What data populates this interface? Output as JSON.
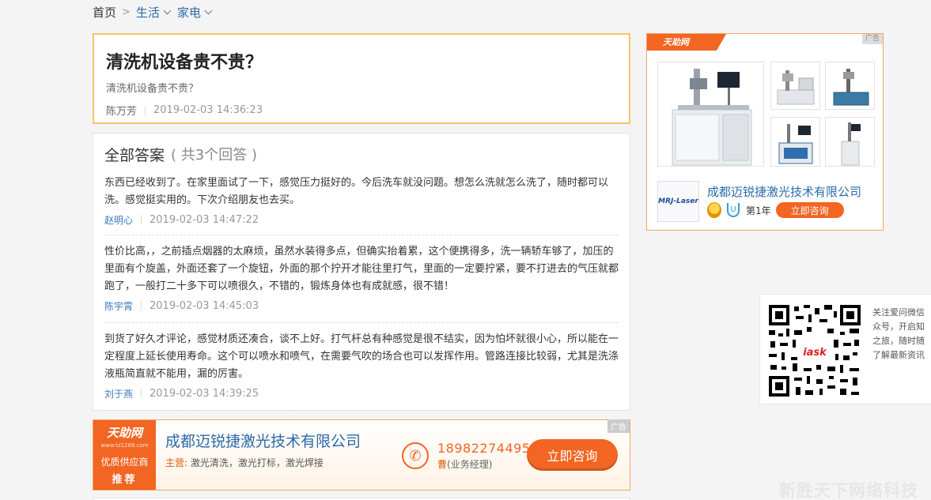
{
  "breadcrumb": {
    "home": "首页",
    "separator": ">",
    "level1": "生活",
    "level2": "家电"
  },
  "question": {
    "title": "清洗机设备贵不贵？",
    "description": "清洗机设备贵不贵？",
    "author": "陈万芳",
    "time": "2019-02-03 14:36:23"
  },
  "answers_section": {
    "heading": "全部答案",
    "count_prefix": "( 共",
    "count": "3",
    "count_suffix": "个回答 )",
    "items": [
      {
        "text": "东西已经收到了。在家里面试了一下，感觉压力挺好的。今后洗车就没问题。想怎么洗就怎么洗了，随时都可以洗。感觉挺实用的。下次介绍朋友也去买。",
        "user": "赵明心",
        "time": "2019-02-03 14:47:22"
      },
      {
        "text": "性价比高，，之前插点烟器的太麻烦，虽然水装得多点，但确实抬着累，这个便携得多，洗一辆轿车够了，加压的里面有个旋盖，外面还套了一个旋钮，外面的那个拧开才能往里打气，里面的一定要拧紧，要不打进去的气压就都跑了，一般打二十多下可以喷很久，不错的，锻炼身体也有成就感，很不错！",
        "user": "陈宇霄",
        "time": "2019-02-03 14:45:03"
      },
      {
        "text": "到货了好久才评论，感觉材质还凑合，谈不上好。打气杆总有种感觉是很不结实，因为怕坏就很小心，所以能在一定程度上延长使用寿命。这个可以喷水和喷气，在需要气吹的场合也可以发挥作用。管路连接比较弱，尤其是洗涤液瓶简直就不能用，漏的厉害。",
        "user": "刘于燕",
        "time": "2019-02-03 14:39:25"
      }
    ]
  },
  "bottom_ad": {
    "tag": "广告",
    "logo_brand": "天助网",
    "logo_url": "www.tz1288.com",
    "logo_line1": "优质供应商",
    "logo_line2": "推荐",
    "company": "成都迈锐捷激光技术有限公司",
    "main_label": "主营:",
    "main_products": "激光清洗，激光打标，激光焊接",
    "phone": "18982274495",
    "contact_surname": "曹",
    "contact_role": "(业务经理)",
    "button": "立即咨询"
  },
  "right_ad": {
    "tag": "广告",
    "logo_brand": "天助网",
    "company_logo": "MRJ-Laser",
    "company": "成都迈锐捷激光技术有限公司",
    "year": "第1年",
    "button": "立即咨询"
  },
  "qr_panel": {
    "lines": [
      "关注爱问微信",
      "众号，开启知",
      "之旅，随时随",
      "了解最新资讯"
    ]
  },
  "watermark": "新胜天下网络科技",
  "colors": {
    "accent_orange": "#f26522",
    "link_blue": "#2b6aa8",
    "question_border": "#f6c26b"
  }
}
